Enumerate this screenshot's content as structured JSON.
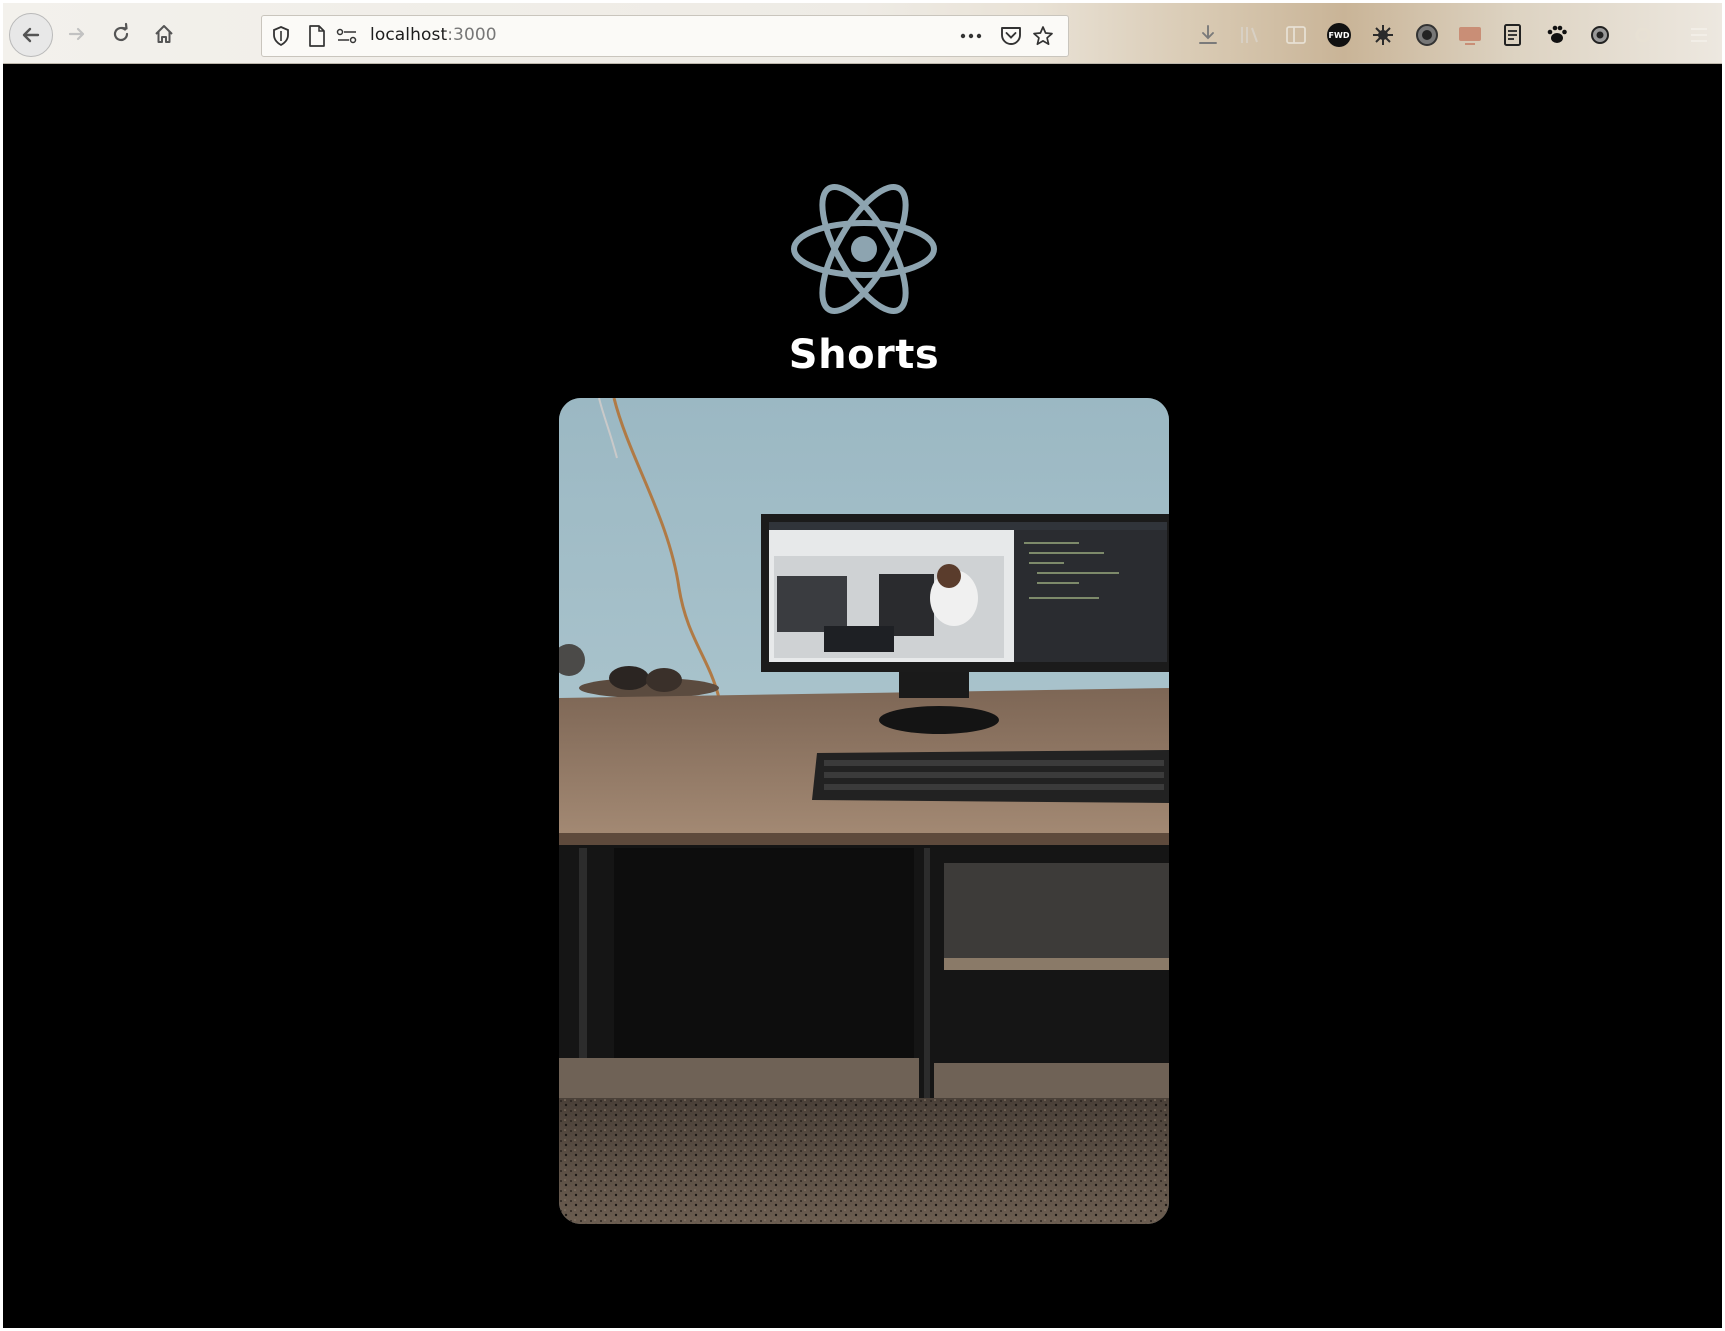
{
  "browser": {
    "url_host": "localhost",
    "url_port": ":3000",
    "icons": {
      "back": "back-arrow-icon",
      "forward": "forward-arrow-icon",
      "reload": "reload-icon",
      "home": "home-icon",
      "shield": "tracking-protection-icon",
      "page": "page-info-icon",
      "permissions": "permissions-icon",
      "more": "more-actions-icon",
      "pocket": "pocket-icon",
      "bookmark": "bookmark-star-icon",
      "downloads": "downloads-icon",
      "library": "library-icon",
      "sidebar": "sidebar-icon",
      "menu": "hamburger-menu-icon"
    },
    "extension_badge_text": "FWD"
  },
  "page": {
    "title": "Shorts",
    "logo": "react-logo-icon",
    "background_color": "#000000",
    "title_color": "#ffffff",
    "logo_color": "#8da4b0"
  },
  "video": {
    "content": "video-frame-desk-with-monitor"
  }
}
